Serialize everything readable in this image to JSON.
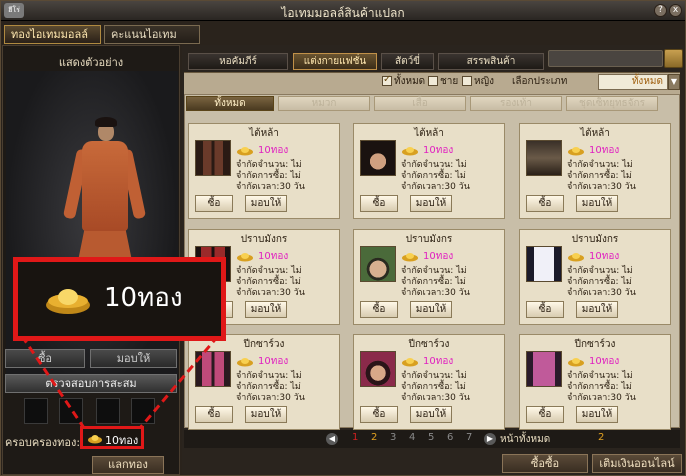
{
  "window": {
    "title": "ไอเทมมอลล์สินค้าแปลก",
    "logo_text": "ฮีโร่",
    "help_glyph": "?",
    "close_glyph": "x"
  },
  "top_tabs": [
    {
      "label": "ทองไอเทมมอลล์"
    },
    {
      "label": "คะแนนไอเทมมอลล์"
    }
  ],
  "left": {
    "preview_title": "แสดงตัวอย่าง",
    "buy_label": "ซื้อ",
    "give_label": "มอบให้",
    "check_label": "ตรวจสอบการสะสม",
    "balance_label": "ครอบครองทอง:",
    "balance_value": "10ทอง",
    "exchange_label": "แลกทอง"
  },
  "zoom": {
    "value": "10ทอง"
  },
  "categories": [
    {
      "label": "หอคัมภีร์"
    },
    {
      "label": "แต่งกายแฟชั่น"
    },
    {
      "label": "สัตว์ขี่"
    },
    {
      "label": "สรรพสินค้า"
    }
  ],
  "filters": {
    "all": "ทั้งหมด",
    "male": "ชาย",
    "female": "หญิง",
    "type_label": "เลือกประเภท",
    "select_value": "ทั้งหมด"
  },
  "subtabs": [
    {
      "label": "ทั้งหมด"
    },
    {
      "label": "หมวก"
    },
    {
      "label": "เสื้อ"
    },
    {
      "label": "รองเท้า"
    },
    {
      "label": "ชุดเซ็ทยุทธจักร"
    }
  ],
  "items": [
    {
      "name": "ไต้หล้า",
      "price": "10ทอง",
      "limit_qty": "จำกัดจำนวน: ไม่",
      "limit_buy": "จำกัดการซื้อ: ไม่",
      "limit_time": "จำกัดเวลา:30 วัน",
      "buy": "ซื้อ",
      "give": "มอบให้",
      "art": "boots"
    },
    {
      "name": "ไต้หล้า",
      "price": "10ทอง",
      "limit_qty": "จำกัดจำนวน: ไม่",
      "limit_buy": "จำกัดการซื้อ: ไม่",
      "limit_time": "จำกัดเวลา:30 วัน",
      "buy": "ซื้อ",
      "give": "มอบให้",
      "art": "face-hair"
    },
    {
      "name": "ไต้หล้า",
      "price": "10ทอง",
      "limit_qty": "จำกัดจำนวน: ไม่",
      "limit_buy": "จำกัดการซื้อ: ไม่",
      "limit_time": "จำกัดเวลา:30 วัน",
      "buy": "ซื้อ",
      "give": "มอบให้",
      "art": "robe"
    },
    {
      "name": "ปราบมังกร",
      "price": "10ทอง",
      "limit_qty": "จำกัดจำนวน: ไม่",
      "limit_buy": "จำกัดการซื้อ: ไม่",
      "limit_time": "จำกัดเวลา:30 วัน",
      "buy": "ซื้อ",
      "give": "มอบให้",
      "art": "boots-red"
    },
    {
      "name": "ปราบมังกร",
      "price": "10ทอง",
      "limit_qty": "จำกัดจำนวน: ไม่",
      "limit_buy": "จำกัดการซื้อ: ไม่",
      "limit_time": "จำกัดเวลา:30 วัน",
      "buy": "ซื้อ",
      "give": "มอบให้",
      "art": "face-hat"
    },
    {
      "name": "ปราบมังกร",
      "price": "10ทอง",
      "limit_qty": "จำกัดจำนวน: ไม่",
      "limit_buy": "จำกัดการซื้อ: ไม่",
      "limit_time": "จำกัดเวลา:30 วัน",
      "buy": "ซื้อ",
      "give": "มอบให้",
      "art": "robe-white"
    },
    {
      "name": "ปีกซาร์วง",
      "price": "10ทอง",
      "limit_qty": "จำกัดจำนวน: ไม่",
      "limit_buy": "จำกัดการซื้อ: ไม่",
      "limit_time": "จำกัดเวลา:30 วัน",
      "buy": "ซื้อ",
      "give": "มอบให้",
      "art": "boots-pink"
    },
    {
      "name": "ปีกซาร์วง",
      "price": "10ทอง",
      "limit_qty": "จำกัดจำนวน: ไม่",
      "limit_buy": "จำกัดการซื้อ: ไม่",
      "limit_time": "จำกัดเวลา:30 วัน",
      "buy": "ซื้อ",
      "give": "มอบให้",
      "art": "face-pink"
    },
    {
      "name": "ปีกซาร์วง",
      "price": "10ทอง",
      "limit_qty": "จำกัดจำนวน: ไม่",
      "limit_buy": "จำกัดการซื้อ: ไม่",
      "limit_time": "จำกัดเวลา:30 วัน",
      "buy": "ซื้อ",
      "give": "มอบให้",
      "art": "robe-pink"
    }
  ],
  "pagination": {
    "pages": [
      "1",
      "2",
      "3",
      "4",
      "5",
      "6",
      "7"
    ],
    "current": "2",
    "all_label": "หน้าทั้งหมด",
    "total": "2",
    "prev_glyph": "◀",
    "next_glyph": "▶"
  },
  "actions": {
    "buy": "ซื้อซื้อ",
    "topup": "เติมเงินออนไลน์"
  },
  "colors": {
    "price": "#e020c0",
    "highlight": "#e01818",
    "gold": "#e0a020"
  }
}
